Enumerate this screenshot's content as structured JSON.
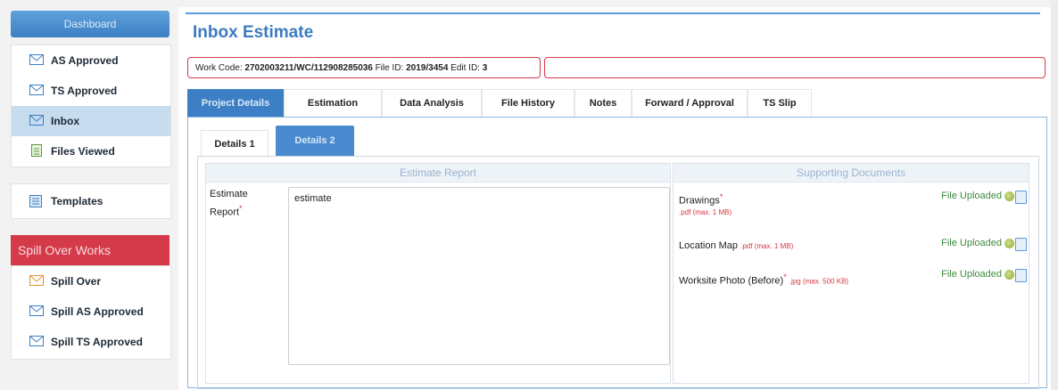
{
  "sidebar": {
    "dashboard_label": "Dashboard",
    "items": [
      {
        "label": "AS Approved",
        "icon": "mail-icon"
      },
      {
        "label": "TS Approved",
        "icon": "mail-icon"
      },
      {
        "label": "Inbox",
        "icon": "mail-icon"
      },
      {
        "label": "Files Viewed",
        "icon": "document-icon"
      }
    ],
    "templates_label": "Templates",
    "spill_heading": "Spill Over Works",
    "spill_items": [
      {
        "label": "Spill Over"
      },
      {
        "label": "Spill AS Approved"
      },
      {
        "label": "Spill TS Approved"
      }
    ]
  },
  "page": {
    "title": "Inbox Estimate",
    "work_code_label": "Work Code:",
    "work_code": "2702003211/WC/112908285036",
    "file_id_label": "File ID:",
    "file_id": "2019/3454",
    "edit_id_label": "Edit ID:",
    "edit_id": "3"
  },
  "tabs": [
    {
      "label": "Project Details"
    },
    {
      "label": "Estimation"
    },
    {
      "label": "Data Analysis"
    },
    {
      "label": "File History"
    },
    {
      "label": "Notes"
    },
    {
      "label": "Forward / Approval"
    },
    {
      "label": "TS Slip"
    }
  ],
  "subtabs": [
    {
      "label": "Details 1"
    },
    {
      "label": "Details 2"
    }
  ],
  "estimate": {
    "section_title": "Estimate Report",
    "label_line1": "Estimate",
    "label_line2": "Report",
    "required_mark": "*",
    "value": "estimate"
  },
  "documents": {
    "section_title": "Supporting Documents",
    "items": [
      {
        "name": "Drawings",
        "required": "*",
        "hint": ".pdf (max. 1 MB)",
        "status": "File Uploaded"
      },
      {
        "name": "Location Map",
        "required": "",
        "hint": ".pdf (max. 1 MB)",
        "status": "File Uploaded"
      },
      {
        "name": "Worksite Photo (Before)",
        "required": "*",
        "hint": ".jpg (max. 500 KB)",
        "status": "File Uploaded"
      }
    ]
  },
  "colors": {
    "accent_blue": "#3c7fc4",
    "spill_red": "#d43a4a",
    "required_red": "#d9363e",
    "uploaded_green": "#3d8b3d"
  }
}
